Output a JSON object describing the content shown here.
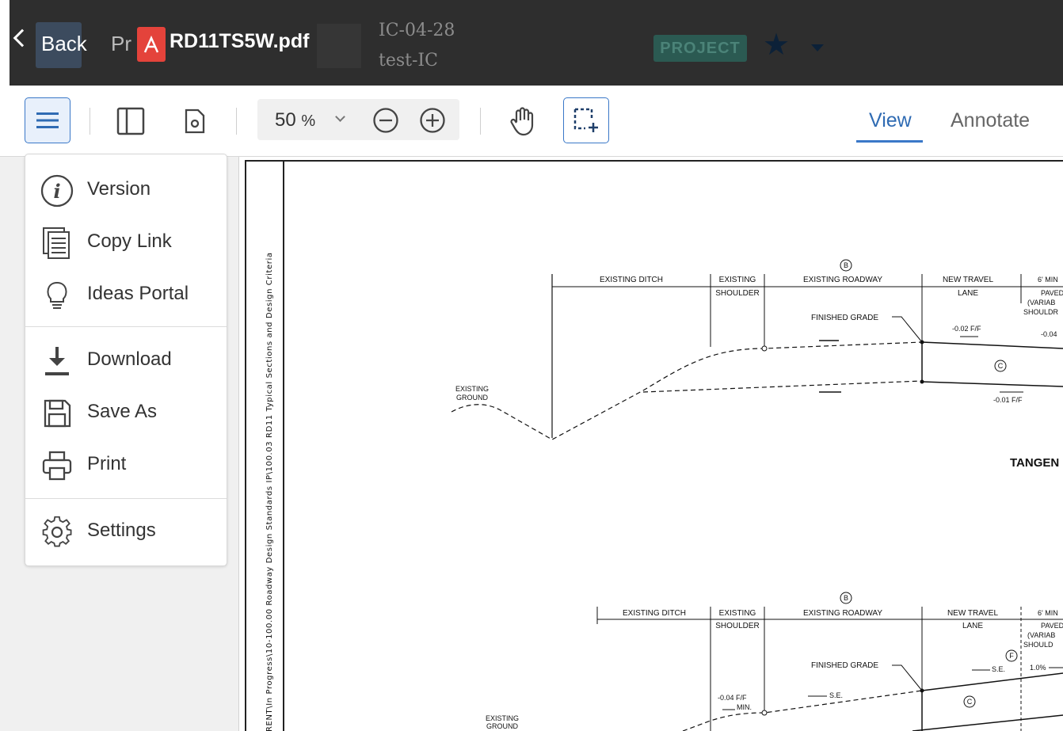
{
  "header": {
    "back_label": "Back",
    "project_ghost": "Pr",
    "filename": "RD11TS5W.pdf",
    "ic_code": "IC-04-28",
    "ic_name": "test-IC",
    "project_badge": "PROJECT"
  },
  "toolbar": {
    "zoom_value": "50",
    "zoom_unit": "%",
    "tabs": [
      {
        "label": "View",
        "active": true
      },
      {
        "label": "Annotate",
        "active": false
      }
    ]
  },
  "menu": {
    "items": [
      {
        "label": "Version",
        "icon": "info-icon"
      },
      {
        "label": "Copy Link",
        "icon": "copy-link-icon"
      },
      {
        "label": "Ideas Portal",
        "icon": "lightbulb-icon"
      },
      {
        "label": "Download",
        "icon": "download-icon"
      },
      {
        "label": "Save As",
        "icon": "save-icon"
      },
      {
        "label": "Print",
        "icon": "print-icon"
      },
      {
        "label": "Settings",
        "icon": "gear-icon"
      }
    ]
  },
  "document": {
    "sidebar_text": "RENT\\In Progress\\10-100.00 Roadway Design Standards IP\\100.03 RD11 Typical Sections and Design Criteria",
    "section1": {
      "existing_ditch": "EXISTING DITCH",
      "existing": "EXISTING",
      "shoulder": "SHOULDER",
      "existing_roadway": "EXISTING ROADWAY",
      "new_travel": "NEW TRAVEL",
      "lane": "LANE",
      "six_min": "6' MIN",
      "paved": "PAVED",
      "variab": "(VARIAB",
      "shouldr": "SHOULDR",
      "finished_grade": "FINISHED GRADE",
      "slope1": "-0.02 F/F",
      "slope2": "-0.04",
      "slope3": "-0.01 F/F",
      "existing_ground_1": "EXISTING",
      "existing_ground_2": "GROUND",
      "b_marker": "B",
      "c_marker": "C",
      "tangent": "TANGEN"
    },
    "section2": {
      "existing_ditch": "EXISTING DITCH",
      "existing": "EXISTING",
      "shoulder": "SHOULDER",
      "existing_roadway": "EXISTING ROADWAY",
      "new_travel": "NEW TRAVEL",
      "lane": "LANE",
      "six_min": "6' MIN",
      "paved": "PAVED",
      "variab": "(VARIAB",
      "shouldr": "SHOULD",
      "finished_grade": "FINISHED GRADE",
      "se1": "S.E.",
      "se2": "S.E.",
      "pct": "1.0%",
      "slope": "-0.04 F/F",
      "min": "MIN.",
      "existing_ground_1": "EXISTING",
      "existing_ground_2": "GROUND",
      "b_marker": "B",
      "c_marker": "C",
      "f_marker": "F"
    }
  }
}
